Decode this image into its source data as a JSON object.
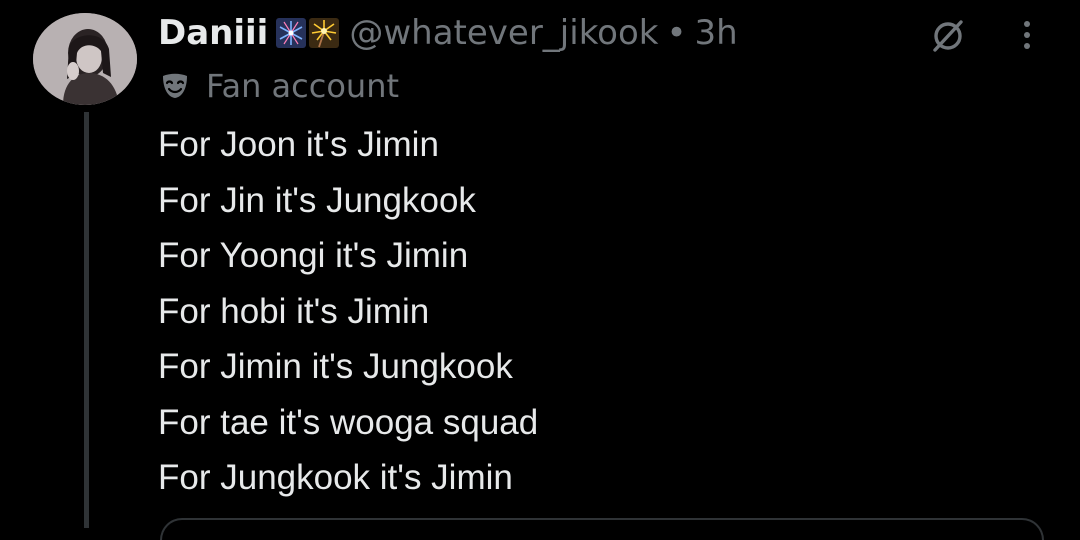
{
  "user": {
    "display_name": "Daniii",
    "name_emojis": [
      "fireworks-emoji",
      "sparkler-emoji"
    ],
    "handle": "@whatever_jikook",
    "separator": "•",
    "time_ago": "3h",
    "label_icon": "mask-icon",
    "label": "Fan account",
    "avatar_icon": "avatar-photo"
  },
  "actions": {
    "grok_icon": "grok-icon",
    "more_icon": "more-vertical-icon"
  },
  "tweet": {
    "lines": [
      "For Joon it's Jimin",
      "For Jin it's Jungkook",
      "For Yoongi it's Jimin",
      "For hobi it's Jimin",
      "For Jimin it's Jungkook",
      "For tae it's wooga squad",
      "For Jungkook it's Jimin"
    ]
  },
  "colors": {
    "background": "#000000",
    "primary_text": "#e7e9ea",
    "secondary_text": "#71767b",
    "border": "#2f3336"
  }
}
